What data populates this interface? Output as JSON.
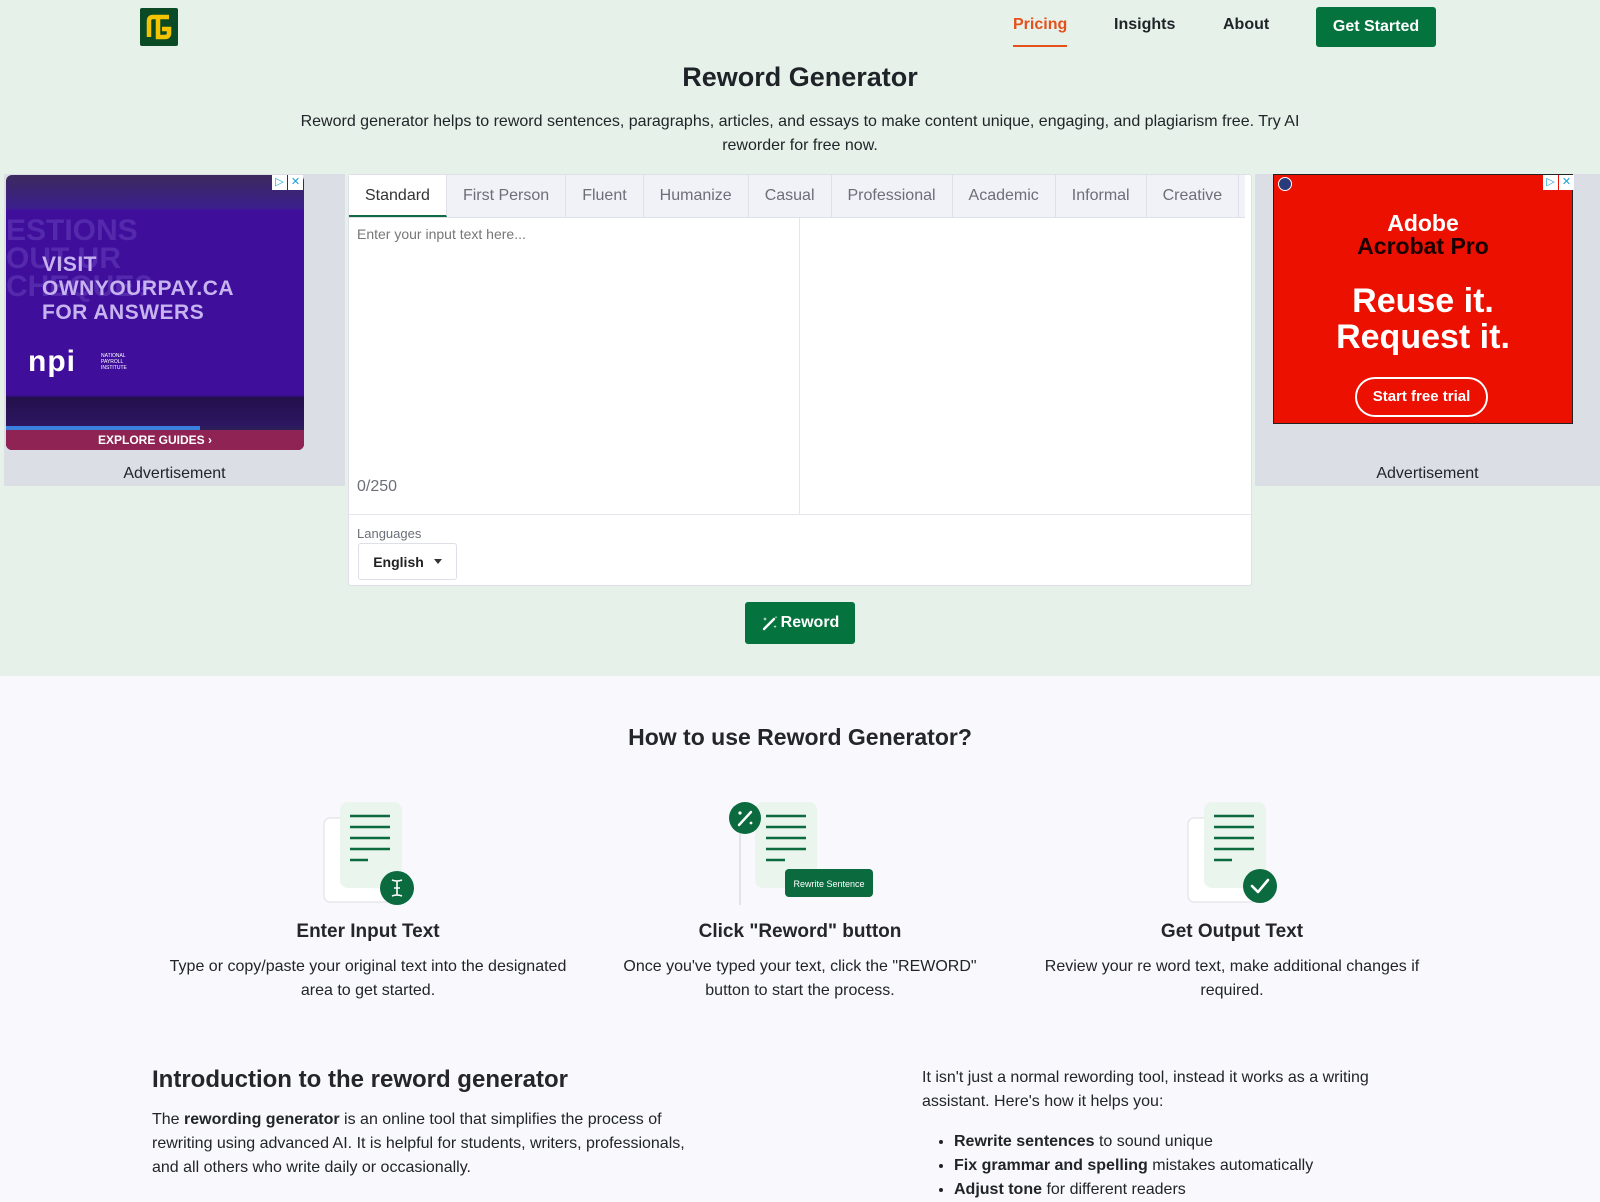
{
  "header": {
    "logo": "logo",
    "nav": [
      {
        "label": "Pricing",
        "active": true
      },
      {
        "label": "Insights",
        "active": false
      },
      {
        "label": "About",
        "active": false
      }
    ],
    "cta_label": "Get Started"
  },
  "hero": {
    "title": "Reword Generator",
    "subtitle": "Reword generator helps to reword sentences, paragraphs, articles, and essays to make content unique, engaging, and plagiarism free. Try AI reworder for free now."
  },
  "ads": {
    "left": {
      "ghost_text": "ESTIONS OUT UR CHEQUE?",
      "headline_lines": [
        "VISIT",
        "OWNYOURPAY.CA",
        "FOR ANSWERS"
      ],
      "brand": "npi",
      "brand_sub": "NATIONAL PAYROLL INSTITUTE",
      "cta": "EXPLORE GUIDES ›",
      "video_progress": 0.65,
      "label": "Advertisement"
    },
    "right": {
      "brand_line1": "Adobe",
      "brand_line2": "Acrobat Pro",
      "tagline_line1": "Reuse it.",
      "tagline_line2": "Request it.",
      "cta": "Start free trial",
      "label": "Advertisement"
    },
    "adchoices_icon": "▷",
    "close_icon": "✕"
  },
  "editor": {
    "tabs": [
      {
        "label": "Standard",
        "active": true
      },
      {
        "label": "First Person",
        "active": false
      },
      {
        "label": "Fluent",
        "active": false
      },
      {
        "label": "Humanize",
        "active": false
      },
      {
        "label": "Casual",
        "active": false
      },
      {
        "label": "Professional",
        "active": false
      },
      {
        "label": "Academic",
        "active": false
      },
      {
        "label": "Informal",
        "active": false
      },
      {
        "label": "Creative",
        "active": false
      }
    ],
    "input_placeholder": "Enter your input text here...",
    "input_value": "",
    "output_value": "",
    "counter": "0/250",
    "languages_label": "Languages",
    "language_selected": "English"
  },
  "reword_button": {
    "label": "Reword",
    "icon": "magic-wand-icon"
  },
  "how_to": {
    "title": "How to use Reword Generator?",
    "steps": [
      {
        "title": "Enter Input Text",
        "desc": "Type or copy/paste your original text into the designated area to get started.",
        "icon": "text-cursor-icon"
      },
      {
        "title": "Click \"Reword\" button",
        "desc": "Once you've typed your text, click the \"REWORD\" button to start the process.",
        "icon": "magic-wand-icon",
        "badge": "Rewrite Sentence"
      },
      {
        "title": "Get Output Text",
        "desc": "Review your re word text, make additional changes if required.",
        "icon": "check-icon"
      }
    ]
  },
  "intro": {
    "title": "Introduction to the reword generator",
    "text_pre": "The ",
    "text_bold": "rewording generator",
    "text_post": " is an online tool that simplifies the process of rewriting using advanced AI. It is helpful for students, writers, professionals, and all others who write daily or occasionally.",
    "right_text": "It isn't just a normal rewording tool, instead it works as a writing assistant. Here's how it helps you:",
    "bullets": [
      {
        "bold": "Rewrite sentences",
        "rest": " to sound unique"
      },
      {
        "bold": "Fix grammar and spelling",
        "rest": " mistakes automatically"
      },
      {
        "bold": "Adjust tone",
        "rest": " for different readers"
      }
    ]
  },
  "colors": {
    "brand_green": "#04733e",
    "active_orange": "#e5501b",
    "hero_bg": "#e6f1ea",
    "logo_yellow": "#f5c400"
  }
}
